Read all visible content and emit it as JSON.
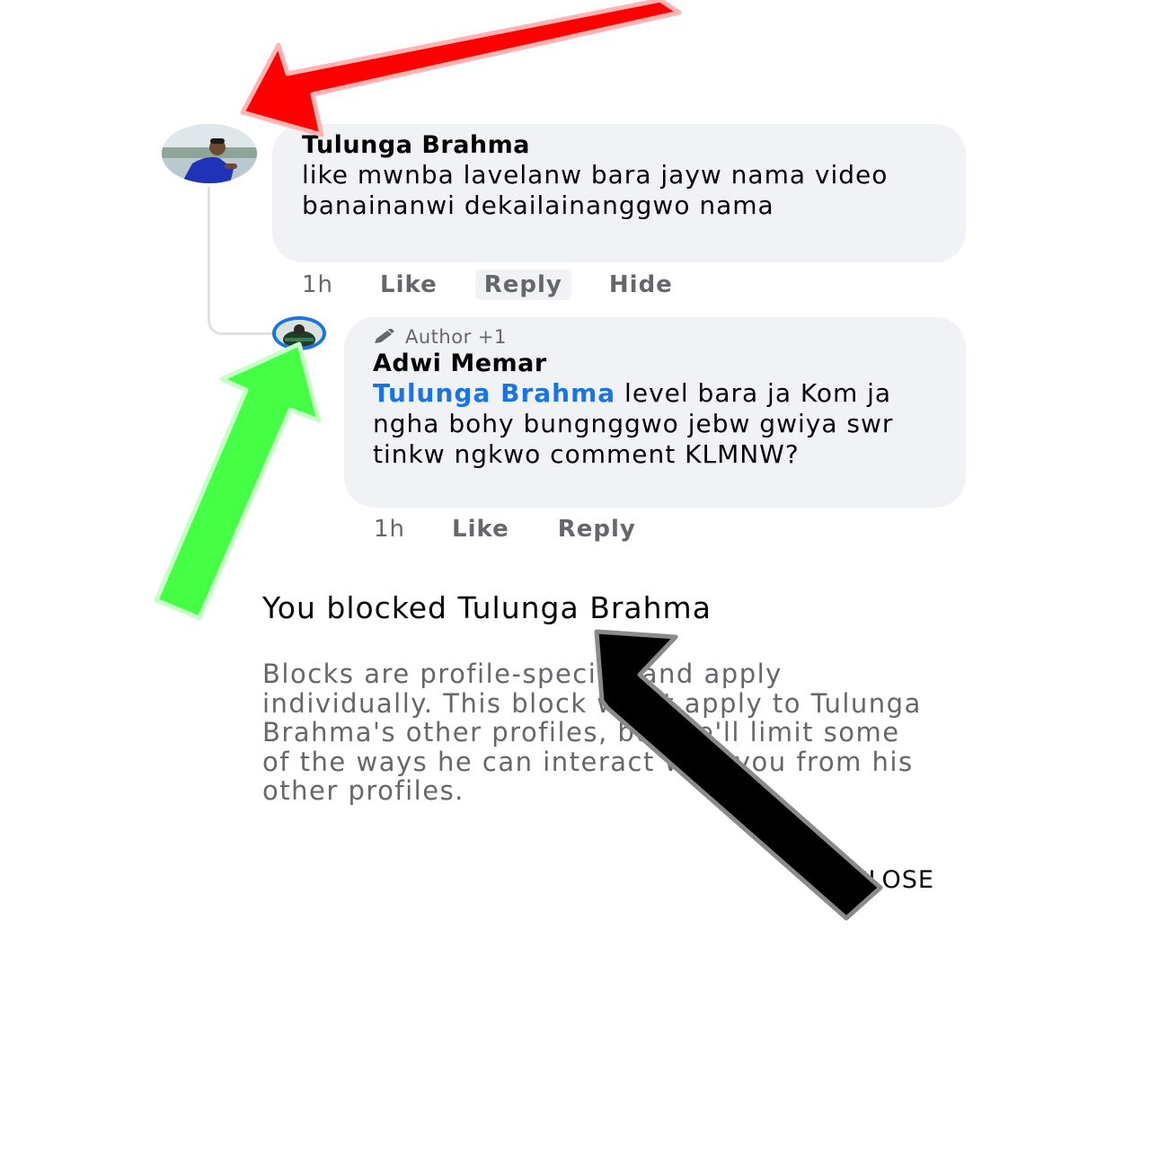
{
  "comment1": {
    "author": "Tulunga Brahma",
    "text": "like mwnba lavelanw bara jayw nama video banainanwi dekailainanggwo nama",
    "time": "1h",
    "like_label": "Like",
    "reply_label": "Reply",
    "hide_label": "Hide"
  },
  "comment2": {
    "badge": "Author +1",
    "author": "Adwi Memar",
    "mention": "Tulunga Brahma",
    "text": " level bara ja Kom ja ngha bohy bungnggwo jebw gwiya  swr tinkw ngkwo comment KLMNW?",
    "time": "1h",
    "like_label": "Like",
    "reply_label": "Reply"
  },
  "dialog": {
    "title": "You blocked Tulunga Brahma",
    "body": "Blocks are profile-specific and apply individually. This block won't apply to Tulunga Brahma's other profiles, but we'll limit some of the ways he can interact with you from his other profiles.",
    "close_label": "CLOSE"
  },
  "colors": {
    "bubble_bg": "#f0f2f5",
    "mention": "#1b74e4",
    "secondary_text": "#65676b",
    "arrow_red": "#ff0000",
    "arrow_green": "#44ff44",
    "arrow_black": "#000000"
  },
  "icons": {
    "author_badge": "pencil-icon"
  }
}
